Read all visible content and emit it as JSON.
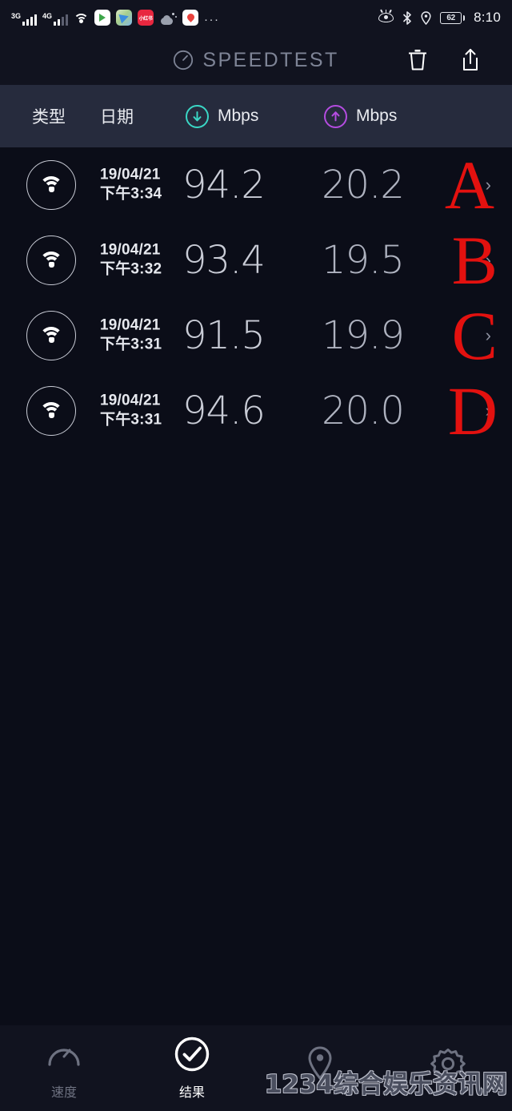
{
  "status_bar": {
    "sim1_network": "3G",
    "sim2_network": "4G",
    "wifi_icon": "wifi-icon",
    "app_icons": [
      "video-app-icon",
      "maps-app-icon",
      "xiaohongshu-app-icon",
      "weather-icon",
      "location-app-icon"
    ],
    "overflow": "···",
    "eyecare_icon": "eye-care-icon",
    "bluetooth_icon": "bluetooth-icon",
    "location_icon": "location-pin-icon",
    "battery_level": "62",
    "time": "8:10"
  },
  "app_bar": {
    "logo_icon": "speedometer-icon",
    "title": "SPEEDTEST",
    "delete_label": "delete-icon",
    "share_label": "share-icon"
  },
  "columns": {
    "type": "类型",
    "date": "日期",
    "download_unit": "Mbps",
    "upload_unit": "Mbps",
    "download_color": "#3ad6c5",
    "upload_color": "#b44ce0"
  },
  "results": [
    {
      "connection_icon": "wifi-icon",
      "date": "19/04/21",
      "time": "下午3:34",
      "download": "94.2",
      "upload": "20.2",
      "chevron": "›",
      "marker": "A"
    },
    {
      "connection_icon": "wifi-icon",
      "date": "19/04/21",
      "time": "下午3:32",
      "download": "93.4",
      "upload": "19.5",
      "chevron": "›",
      "marker": "B"
    },
    {
      "connection_icon": "wifi-icon",
      "date": "19/04/21",
      "time": "下午3:31",
      "download": "91.5",
      "upload": "19.9",
      "chevron": "›",
      "marker": "C"
    },
    {
      "connection_icon": "wifi-icon",
      "date": "19/04/21",
      "time": "下午3:31",
      "download": "94.6",
      "upload": "20.0",
      "chevron": "›",
      "marker": "D"
    }
  ],
  "bottom_nav": [
    {
      "icon": "speedometer-icon",
      "label": "速度",
      "active": false
    },
    {
      "icon": "check-circle-icon",
      "label": "结果",
      "active": true
    },
    {
      "icon": "map-pin-icon",
      "label": "",
      "active": false
    },
    {
      "icon": "gear-icon",
      "label": "",
      "active": false
    }
  ],
  "watermark": "1234综合娱乐资讯网",
  "marker_color": "#e3110f"
}
